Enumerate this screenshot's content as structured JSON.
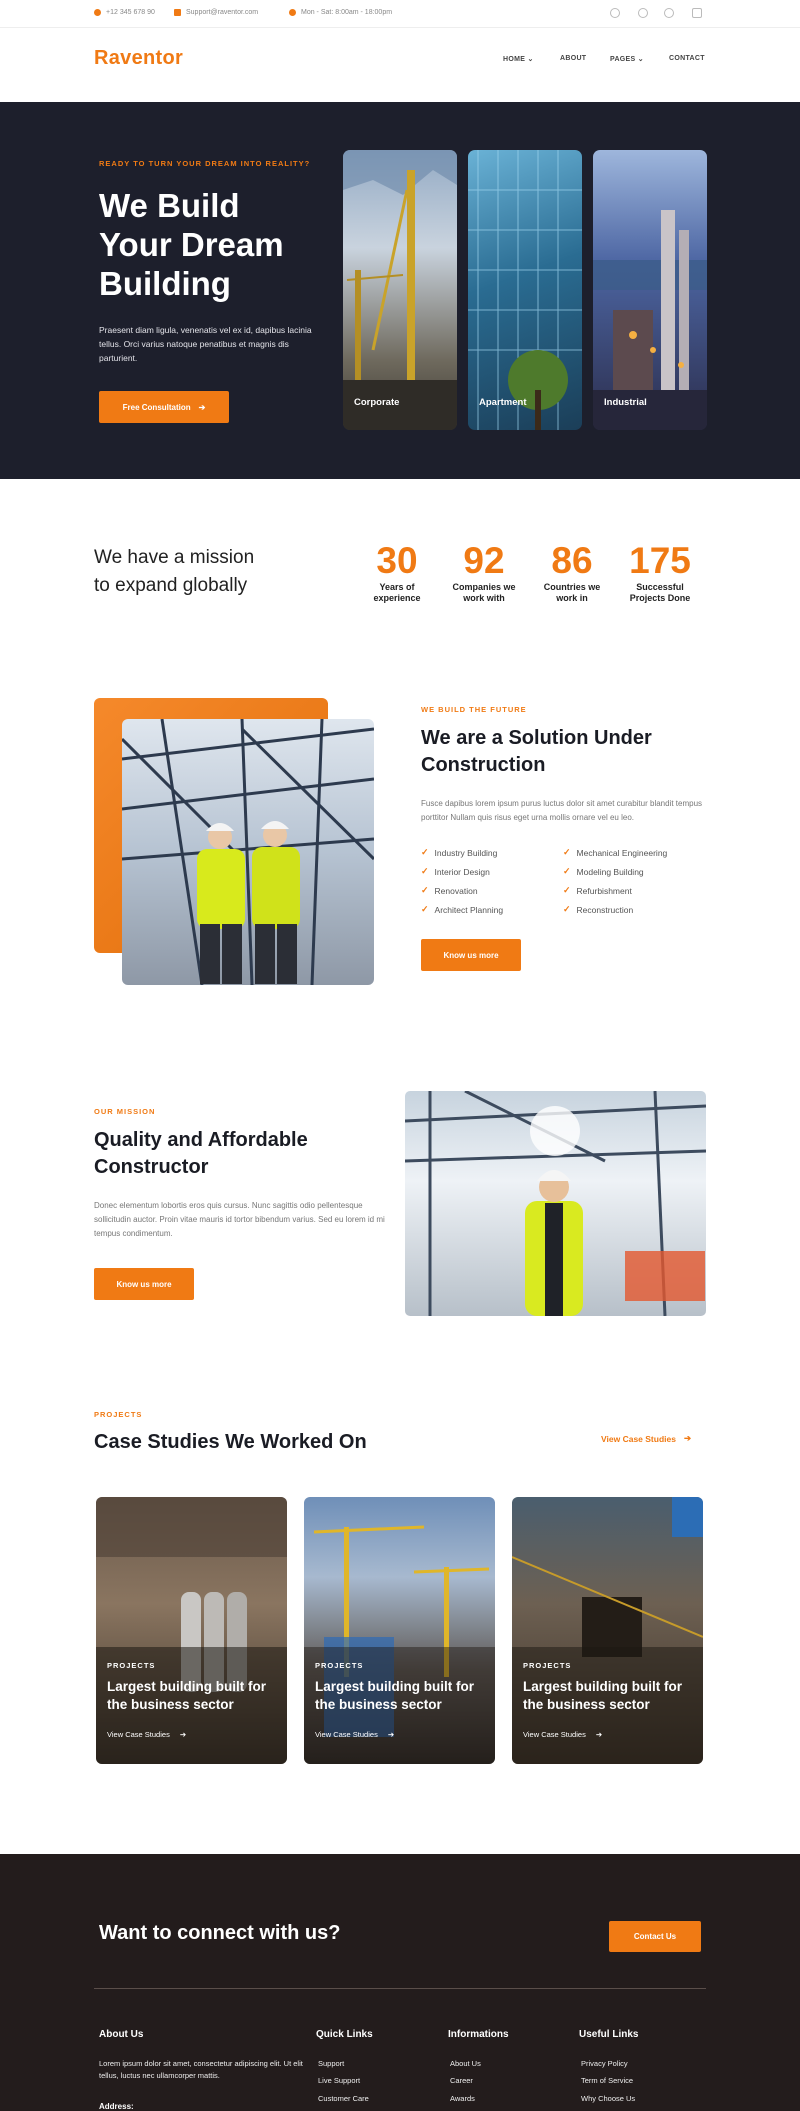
{
  "topbar": {
    "phone": "+12 345 678 90",
    "email": "Support@raventor.com",
    "hours": "Mon - Sat: 8:00am - 18:00pm"
  },
  "header": {
    "logo": "Raventor",
    "nav": [
      "HOME",
      "ABOUT",
      "PAGES",
      "CONTACT"
    ]
  },
  "hero": {
    "eyebrow": "READY TO TURN YOUR DREAM INTO REALITY?",
    "title_lines": [
      "We Build",
      "Your Dream",
      "Building"
    ],
    "text": "Praesent diam ligula, venenatis vel ex id, dapibus lacinia tellus. Orci varius natoque penatibus et magnis dis parturient.",
    "cta": "Free Consultation",
    "cards": [
      "Corporate",
      "Apartment",
      "Industrial"
    ]
  },
  "stats": {
    "heading_lines": [
      "We have a mission",
      "to expand globally"
    ],
    "items": [
      {
        "num": "30",
        "l1": "Years of",
        "l2": "experience"
      },
      {
        "num": "92",
        "l1": "Companies we",
        "l2": "work with"
      },
      {
        "num": "86",
        "l1": "Countries we",
        "l2": "work in"
      },
      {
        "num": "175",
        "l1": "Successful",
        "l2": "Projects Done"
      }
    ]
  },
  "solution": {
    "eyebrow": "WE BUILD THE FUTURE",
    "title_lines": [
      "We are a Solution Under",
      "Construction"
    ],
    "text": "Fusce dapibus lorem ipsum purus luctus dolor sit amet curabitur blandit tempus porttitor Nullam quis risus eget urna mollis ornare vel eu leo.",
    "features_left": [
      "Industry Building",
      "Interior Design",
      "Renovation",
      "Architect Planning"
    ],
    "features_right": [
      "Mechanical Engineering",
      "Modeling Building",
      "Refurbishment",
      "Reconstruction"
    ],
    "cta": "Know us more"
  },
  "mission": {
    "eyebrow": "OUR MISSION",
    "title_lines": [
      "Quality and Affordable",
      "Constructor"
    ],
    "text": "Donec elementum lobortis eros quis cursus. Nunc sagittis odio pellentesque sollicitudin auctor. Proin vitae mauris id tortor bibendum varius. Sed eu lorem id mi tempus condimentum.",
    "cta": "Know us more"
  },
  "projects": {
    "eyebrow": "PROJECTS",
    "title": "Case Studies We Worked On",
    "view_all": "View Case Studies",
    "cards": [
      {
        "tag": "PROJECTS",
        "title": "Largest building built for the business sector",
        "link": "View Case Studies"
      },
      {
        "tag": "PROJECTS",
        "title": "Largest building built for the business sector",
        "link": "View Case Studies"
      },
      {
        "tag": "PROJECTS",
        "title": "Largest building built for the business sector",
        "link": "View Case Studies"
      }
    ]
  },
  "footer": {
    "cta_title": "Want to connect with us?",
    "cta_button": "Contact Us",
    "about_title": "About Us",
    "about_text": "Lorem ipsum dolor sit amet, consectetur adipiscing elit. Ut elit tellus, luctus nec ullamcorper mattis.",
    "address_label": "Address:",
    "col2_title": "Quick Links",
    "col2": [
      "Support",
      "Live Support",
      "Customer Care"
    ],
    "col3_title": "Informations",
    "col3": [
      "About Us",
      "Career",
      "Awards"
    ],
    "col4_title": "Useful Links",
    "col4": [
      "Privacy Policy",
      "Term of Service",
      "Why Choose Us"
    ]
  },
  "colors": {
    "accent": "#f07a14",
    "dark": "#1d1f2c"
  }
}
